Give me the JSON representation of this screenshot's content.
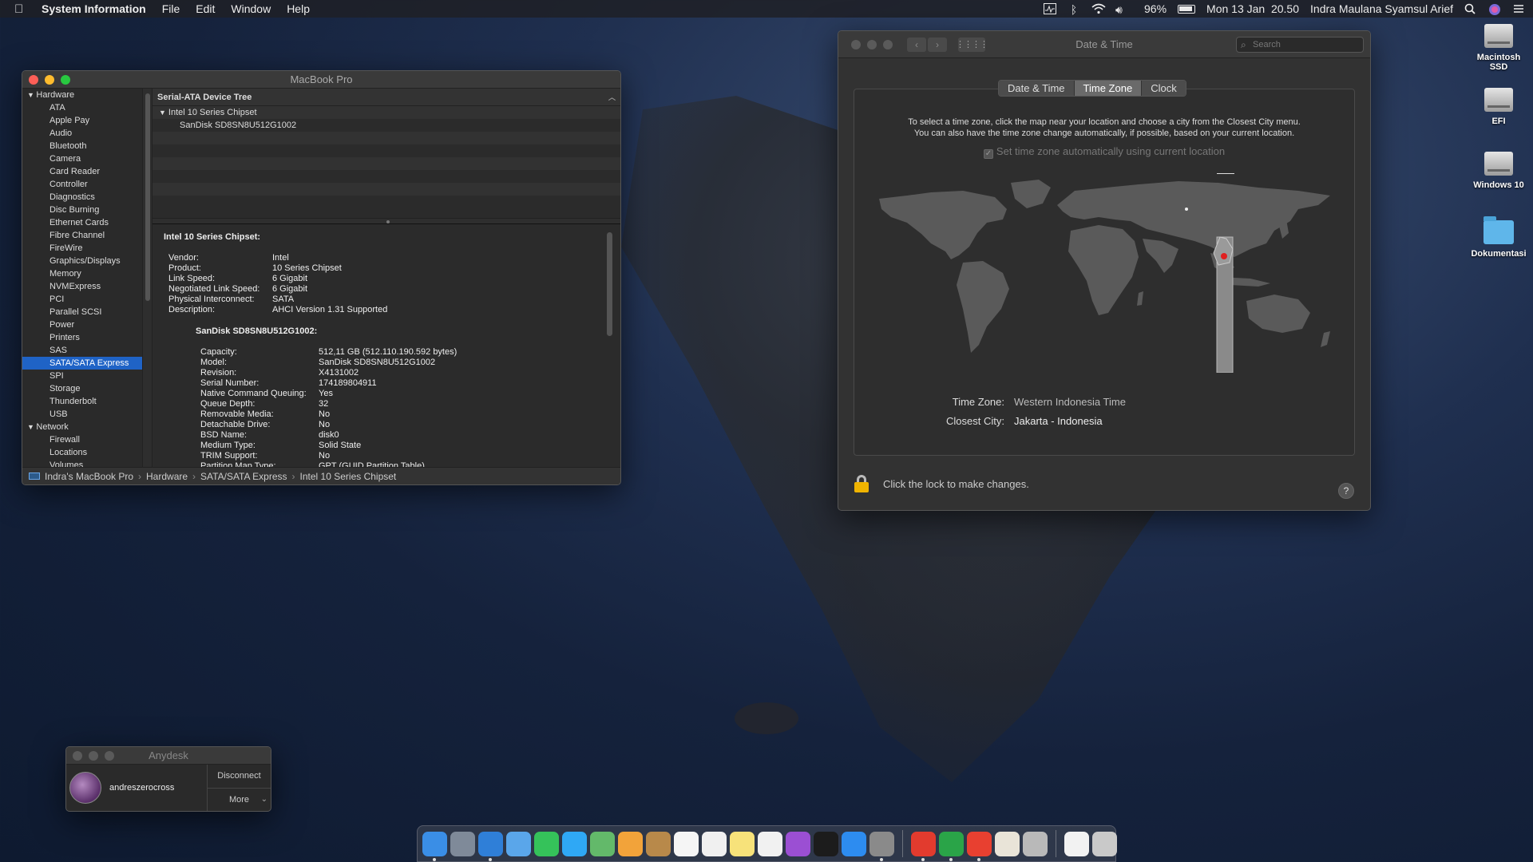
{
  "menubar": {
    "app_name": "System Information",
    "menus": [
      "File",
      "Edit",
      "Window",
      "Help"
    ],
    "battery": "96%",
    "clock": "Mon 13 Jan  20.50",
    "user": "Indra Maulana Syamsul Arief"
  },
  "sysinfo": {
    "title": "MacBook Pro",
    "sidebar": {
      "hardware_label": "Hardware",
      "hardware_items": [
        "ATA",
        "Apple Pay",
        "Audio",
        "Bluetooth",
        "Camera",
        "Card Reader",
        "Controller",
        "Diagnostics",
        "Disc Burning",
        "Ethernet Cards",
        "Fibre Channel",
        "FireWire",
        "Graphics/Displays",
        "Memory",
        "NVMExpress",
        "PCI",
        "Parallel SCSI",
        "Power",
        "Printers",
        "SAS",
        "SATA/SATA Express",
        "SPI",
        "Storage",
        "Thunderbolt",
        "USB"
      ],
      "selected": "SATA/SATA Express",
      "network_label": "Network",
      "network_items": [
        "Firewall",
        "Locations",
        "Volumes"
      ]
    },
    "tree_header": "Serial-ATA Device Tree",
    "tree": {
      "parent": "Intel 10 Series Chipset",
      "child": "SanDisk SD8SN8U512G1002"
    },
    "detail": {
      "heading": "Intel 10 Series Chipset:",
      "fields": [
        {
          "k": "Vendor:",
          "v": "Intel"
        },
        {
          "k": "Product:",
          "v": "10 Series Chipset"
        },
        {
          "k": "Link Speed:",
          "v": "6 Gigabit"
        },
        {
          "k": "Negotiated Link Speed:",
          "v": "6 Gigabit"
        },
        {
          "k": "Physical Interconnect:",
          "v": "SATA"
        },
        {
          "k": "Description:",
          "v": "AHCI Version 1.31 Supported"
        }
      ],
      "sub_heading": "SanDisk SD8SN8U512G1002:",
      "sub_fields": [
        {
          "k": "Capacity:",
          "v": "512,11 GB (512.110.190.592 bytes)"
        },
        {
          "k": "Model:",
          "v": "SanDisk SD8SN8U512G1002"
        },
        {
          "k": "Revision:",
          "v": "X4131002"
        },
        {
          "k": "Serial Number:",
          "v": "174189804911"
        },
        {
          "k": "Native Command Queuing:",
          "v": "Yes"
        },
        {
          "k": "Queue Depth:",
          "v": "32"
        },
        {
          "k": "Removable Media:",
          "v": "No"
        },
        {
          "k": "Detachable Drive:",
          "v": "No"
        },
        {
          "k": "BSD Name:",
          "v": "disk0"
        },
        {
          "k": "Medium Type:",
          "v": "Solid State"
        },
        {
          "k": "TRIM Support:",
          "v": "No"
        },
        {
          "k": "Partition Map Type:",
          "v": "GPT (GUID Partition Table)"
        }
      ]
    },
    "breadcrumb": [
      "Indra's MacBook Pro",
      "Hardware",
      "SATA/SATA Express",
      "Intel 10 Series Chipset"
    ]
  },
  "datetime": {
    "title": "Date & Time",
    "search_placeholder": "Search",
    "tabs": [
      "Date & Time",
      "Time Zone",
      "Clock"
    ],
    "active_tab": "Time Zone",
    "intro_line1": "To select a time zone, click the map near your location and choose a city from the Closest City menu.",
    "intro_line2": "You can also have the time zone change automatically, if possible, based on your current location.",
    "auto_label": "Set time zone automatically using current location",
    "time_zone_label": "Time Zone:",
    "time_zone_value": "Western Indonesia Time",
    "closest_city_label": "Closest City:",
    "closest_city_value": "Jakarta - Indonesia",
    "lock_text": "Click the lock to make changes.",
    "help": "?"
  },
  "desktop_icons": [
    {
      "label": "Macintosh SSD",
      "icon": "disk-icon"
    },
    {
      "label": "EFI",
      "icon": "disk-icon"
    },
    {
      "label": "Windows 10",
      "icon": "disk-icon"
    },
    {
      "label": "Dokumentasi",
      "icon": "folder-icon"
    }
  ],
  "anydesk": {
    "title": "Anydesk",
    "user": "andreszerocross",
    "disconnect": "Disconnect",
    "more": "More"
  },
  "dock": {
    "apps": [
      {
        "name": "finder",
        "color": "#3a8ee6",
        "run": true
      },
      {
        "name": "launchpad",
        "color": "#7f8a99",
        "run": false
      },
      {
        "name": "safari",
        "color": "#2f7fd8",
        "run": true
      },
      {
        "name": "mail",
        "color": "#5aa6ea",
        "run": false
      },
      {
        "name": "facetime",
        "color": "#35c25a",
        "run": false
      },
      {
        "name": "messages",
        "color": "#2fa8f5",
        "run": false
      },
      {
        "name": "maps",
        "color": "#63b96a",
        "run": false
      },
      {
        "name": "photos",
        "color": "#f2a33a",
        "run": false
      },
      {
        "name": "notes-book",
        "color": "#b8894a",
        "run": false
      },
      {
        "name": "calendar",
        "color": "#f5f5f5",
        "run": false
      },
      {
        "name": "reminders",
        "color": "#f0f0f0",
        "run": false
      },
      {
        "name": "notes",
        "color": "#f7e27a",
        "run": false
      },
      {
        "name": "music",
        "color": "#f1f1f1",
        "run": false
      },
      {
        "name": "podcasts",
        "color": "#9b4fd3",
        "run": false
      },
      {
        "name": "tv",
        "color": "#1c1c1c",
        "run": false
      },
      {
        "name": "app-store",
        "color": "#2d8cf0",
        "run": false
      },
      {
        "name": "system-preferences",
        "color": "#8a8a8a",
        "run": true
      }
    ],
    "apps2": [
      {
        "name": "anydesk",
        "color": "#e23b2e",
        "run": true
      },
      {
        "name": "system-information",
        "color": "#2aa448",
        "run": true
      },
      {
        "name": "anydesk-alt",
        "color": "#e84030",
        "run": true
      },
      {
        "name": "text-edit",
        "color": "#e9e4d8",
        "run": false
      },
      {
        "name": "automator",
        "color": "#b9b9b9",
        "run": false
      }
    ],
    "apps3": [
      {
        "name": "documents-stack",
        "color": "#f2f2f2",
        "run": false
      },
      {
        "name": "trash",
        "color": "#c9c9c9",
        "run": false
      }
    ]
  }
}
